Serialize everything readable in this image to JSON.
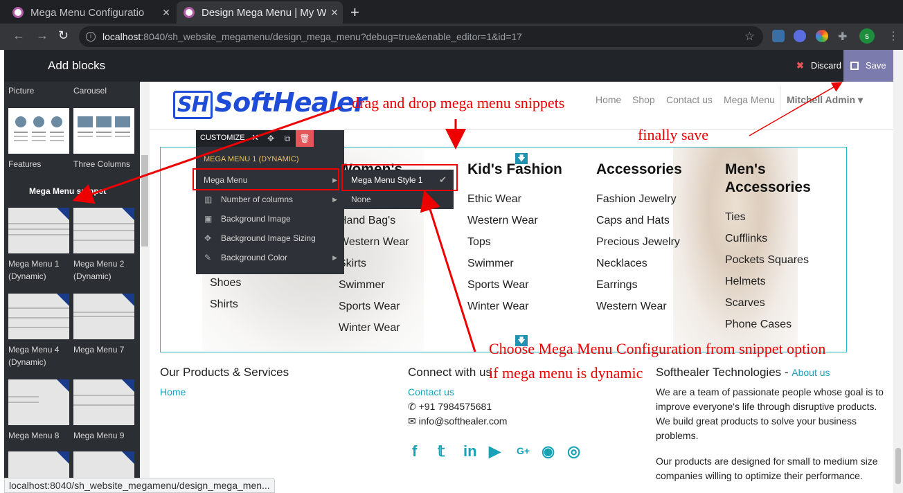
{
  "browser": {
    "tabs": [
      {
        "title": "Mega Menu Configuratio",
        "active": false
      },
      {
        "title": "Design Mega Menu | My W",
        "active": true
      }
    ],
    "url_host": "localhost",
    "url_path": ":8040/sh_website_megamenu/design_mega_menu?debug=true&enable_editor=1&id=17",
    "profile_initial": "s",
    "status_url": "localhost:8040/sh_website_megamenu/design_mega_men..."
  },
  "editor": {
    "add_blocks": "Add blocks",
    "discard": "Discard",
    "save": "Save",
    "top_labels": [
      "Picture",
      "Carousel"
    ],
    "row_labels": [
      "Features",
      "Three Columns"
    ],
    "section_title": "Mega Menu snippet",
    "snippets": [
      {
        "name": "Mega Menu 1 (Dynamic)"
      },
      {
        "name": "Mega Menu 2 (Dynamic)"
      },
      {
        "name": "Mega Menu 4 (Dynamic)"
      },
      {
        "name": "Mega Menu 7"
      },
      {
        "name": "Mega Menu 8"
      },
      {
        "name": "Mega Menu 9"
      }
    ]
  },
  "site": {
    "logo": "SoftHealer",
    "logo_sh": "SH",
    "nav": [
      "Home",
      "Shop",
      "Contact us",
      "Mega Menu"
    ],
    "user": "Mitchell Admin"
  },
  "customize": {
    "title": "CUSTOMIZE",
    "snippet_name": "MEGA MENU 1 (DYNAMIC)",
    "options": [
      "Mega Menu",
      "Number of columns",
      "Background Image",
      "Background Image Sizing",
      "Background Color"
    ],
    "submenu": [
      "Mega Menu Style 1",
      "None"
    ]
  },
  "mega_menu": {
    "columns": [
      {
        "heading": "Women's",
        "items": [
          "Hand Bag's",
          "Western Wear",
          "Skirts",
          "Swimmer",
          "Sports Wear",
          "Winter Wear"
        ]
      },
      {
        "heading": "Kid's Fashion",
        "items": [
          "Ethic Wear",
          "Western Wear",
          "Tops",
          "Swimmer",
          "Sports Wear",
          "Winter Wear"
        ]
      },
      {
        "heading": "Accessories",
        "items": [
          "Fashion Jewelry",
          "Caps and Hats",
          "Precious Jewelry",
          "Necklaces",
          "Earrings",
          "Western Wear"
        ]
      },
      {
        "heading": "Men's Accessories",
        "items": [
          "Ties",
          "Cufflinks",
          "Pockets Squares",
          "Helmets",
          "Scarves",
          "Phone Cases"
        ]
      }
    ],
    "partial_items": [
      "Shoes",
      "Shirts"
    ]
  },
  "footer": {
    "products_title": "Our Products & Services",
    "products_link": "Home",
    "connect_title": "Connect with us",
    "contact_link": "Contact us",
    "phone": "+91 7984575681",
    "email": "info@softhealer.com",
    "company_title": "Softhealer Technologies",
    "about_link": "About us",
    "about_text_1": "We are a team of passionate people whose goal is to improve everyone's life through disruptive products. We build great products to solve your business problems.",
    "about_text_2": "Our products are designed for small to medium size companies willing to optimize their performance."
  },
  "annotations": {
    "drag": "drag and drop mega menu snippets",
    "save": "finally save",
    "choose_1": "Choose Mega Menu Configuration from snippet option",
    "choose_2": "if mega menu is dynamic"
  }
}
